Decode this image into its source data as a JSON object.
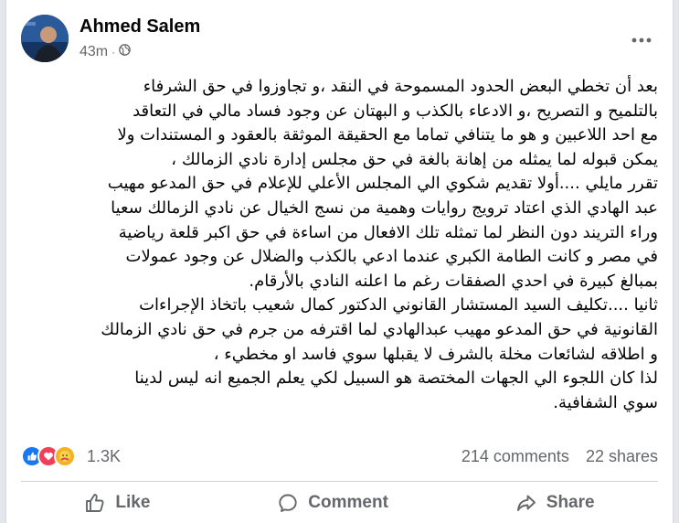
{
  "post": {
    "author": "Ahmed Salem",
    "time": "43m",
    "visibility_icon": "globe-icon",
    "lines": [
      "بعد أن تخطي البعض الحدود المسموحة في النقد ،و تجاوزوا في حق الشرفاء",
      "بالتلميح و التصريح ،و الادعاء بالكذب و البهتان عن وجود فساد مالي في التعاقد",
      "مع احد اللاعبين و هو ما يتنافي تماما مع الحقيقة الموثقة بالعقود و المستندات ولا",
      "يمكن قبوله لما يمثله من إهانة بالغة في حق مجلس إدارة نادي الزمالك ،",
      "تقرر مايلي ....أولا تقديم شكوي الي المجلس الأعلي للإعلام في حق المدعو مهيب",
      "عبد الهادي الذي اعتاد ترويج روايات وهمية من نسج الخيال عن نادي الزمالك سعيا",
      "وراء التريند  دون النظر لما تمثله تلك الافعال من اساءة في حق اكبر قلعة رياضية",
      "في مصر و كانت الطامة الكبري عندما ادعي بالكذب والضلال عن وجود عمولات",
      "بمبالغ كبيرة في احدي الصفقات رغم ما اعلنه النادي بالأرقام.",
      "ثانيا ....تكليف السيد المستشار القانوني الدكتور كمال شعيب باتخاذ الإجراءات",
      "القانونية في حق المدعو مهيب عبدالهادي لما اقترفه من جرم في حق  نادي الزمالك",
      "و اطلاقه لشائعات مخلة بالشرف لا يقبلها سوي فاسد او مخطيء ،",
      "لذا كان اللجوء الي الجهات المختصة هو السبيل لكي يعلم الجميع انه ليس لدينا",
      "سوي الشفافية."
    ]
  },
  "stats": {
    "reaction_count": "1.3K",
    "comments": "214 comments",
    "shares": "22 shares"
  },
  "actions": {
    "like": "Like",
    "comment": "Comment",
    "share": "Share"
  },
  "colors": {
    "like_blue": "#1877f2",
    "love_red": "#f33e58",
    "care_yellow": "#f7b125",
    "secondary_text": "#65676b"
  }
}
